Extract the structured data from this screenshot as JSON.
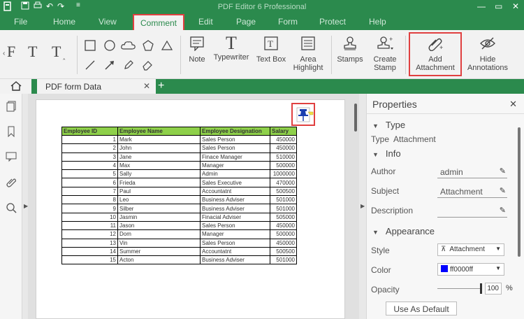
{
  "titlebar": {
    "title": "PDF Editor 6 Professional"
  },
  "menu": [
    "File",
    "Home",
    "View",
    "Comment",
    "Edit",
    "Page",
    "Form",
    "Protect",
    "Help"
  ],
  "ribbon": {
    "note": "Note",
    "typewriter": "Typewriter",
    "textbox": "Text Box",
    "area_highlight": [
      "Area",
      "Highlight"
    ],
    "stamps": "Stamps",
    "create_stamp": [
      "Create",
      "Stamp"
    ],
    "add_attachment": [
      "Add",
      "Attachment"
    ],
    "hide_annotations": [
      "Hide",
      "Annotations"
    ]
  },
  "tab": {
    "name": "PDF form Data"
  },
  "table": {
    "headers": [
      "Employee ID",
      "Employee Name",
      "Employee Designation",
      "Salary"
    ],
    "rows": [
      [
        "1",
        "Mark",
        "Sales Person",
        "450000"
      ],
      [
        "2",
        "John",
        "Sales Person",
        "450000"
      ],
      [
        "3",
        "Jane",
        "Finace Manager",
        "510000"
      ],
      [
        "4",
        "Max",
        "Manager",
        "500000"
      ],
      [
        "5",
        "Sally",
        "Admin",
        "1000000"
      ],
      [
        "6",
        "Frieda",
        "Sales Executive",
        "470000"
      ],
      [
        "7",
        "Paul",
        "Accountatnt",
        "500500"
      ],
      [
        "8",
        "Leo",
        "Business Adviser",
        "501000"
      ],
      [
        "9",
        "Silber",
        "Business Adviser",
        "501000"
      ],
      [
        "10",
        "Jasmin",
        "Finacial Adviser",
        "505000"
      ],
      [
        "11",
        "Jason",
        "Sales Person",
        "450000"
      ],
      [
        "12",
        "Dom",
        "Manager",
        "500000"
      ],
      [
        "13",
        "Vin",
        "Sales Person",
        "450000"
      ],
      [
        "14",
        "Summer",
        "Accountatnt",
        "500500"
      ],
      [
        "15",
        "Acton",
        "Business Adviser",
        "501000"
      ]
    ]
  },
  "properties": {
    "title": "Properties",
    "type_section": "Type",
    "type_label": "Type",
    "type_value": "Attachment",
    "info_section": "Info",
    "author_label": "Author",
    "author_value": "admin",
    "subject_label": "Subject",
    "subject_value": "Attachment",
    "description_label": "Description",
    "description_value": "",
    "appearance_section": "Appearance",
    "style_label": "Style",
    "style_value": "Attachment",
    "color_label": "Color",
    "color_value": "ff0000ff",
    "color_swatch": "#0000ff",
    "opacity_label": "Opacity",
    "opacity_value": "100",
    "opacity_unit": "%",
    "default_button": "Use As Default"
  },
  "colors": {
    "accent": "#2b8a4d",
    "highlight_box": "#e04040",
    "table_header": "#8ed04a"
  }
}
